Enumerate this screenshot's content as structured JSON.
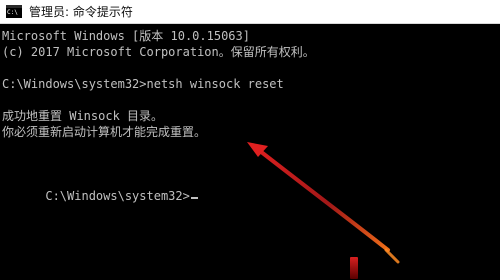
{
  "window": {
    "title": "管理员: 命令提示符",
    "icon": "console-icon",
    "icon_text": "C:\\"
  },
  "console": {
    "lines": [
      "Microsoft Windows [版本 10.0.15063]",
      "(c) 2017 Microsoft Corporation。保留所有权利。",
      "",
      "C:\\Windows\\system32>netsh winsock reset",
      "",
      "成功地重置 Winsock 目录。",
      "你必须重新启动计算机才能完成重置。",
      "",
      "",
      "C:\\Windows\\system32>"
    ]
  },
  "colors": {
    "background": "#000000",
    "text": "#c0c0c0",
    "annotation_arrow": "#e02020"
  }
}
